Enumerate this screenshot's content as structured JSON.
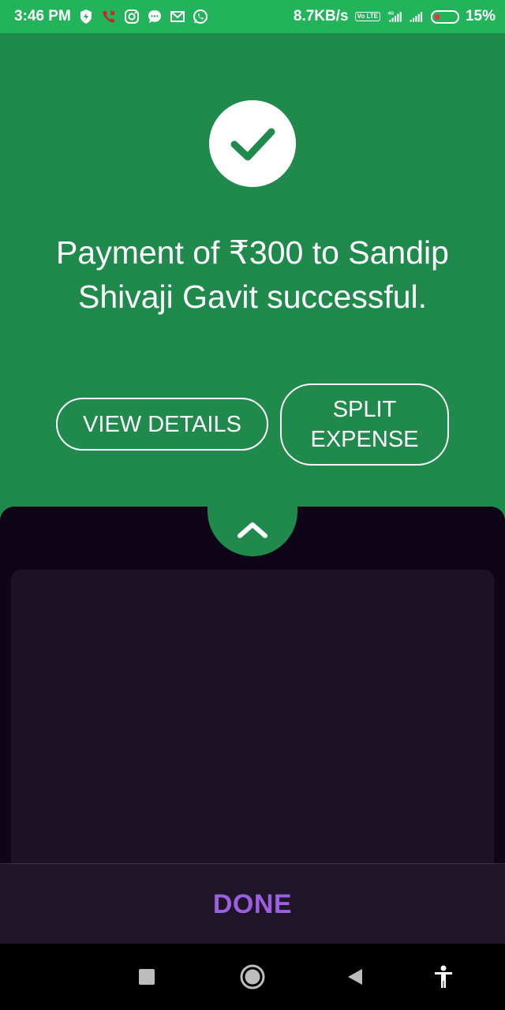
{
  "status_bar": {
    "time": "3:46 PM",
    "net_speed": "8.7KB/s",
    "volte": "Vo LTE",
    "network": "4G",
    "battery": "15%",
    "battery_level": 0.15
  },
  "success": {
    "message": "Payment of ₹300 to Sandip Shivaji Gavit successful.",
    "view_details_label": "VIEW DETAILS",
    "split_expense_label": "SPLIT EXPENSE"
  },
  "footer": {
    "done_label": "DONE"
  },
  "colors": {
    "status_bar": "#23b35b",
    "header_green": "#1f8a4c",
    "sheet_bg": "#0f0519",
    "card_bg": "#1c1426",
    "done_text": "#9c5fe0"
  }
}
